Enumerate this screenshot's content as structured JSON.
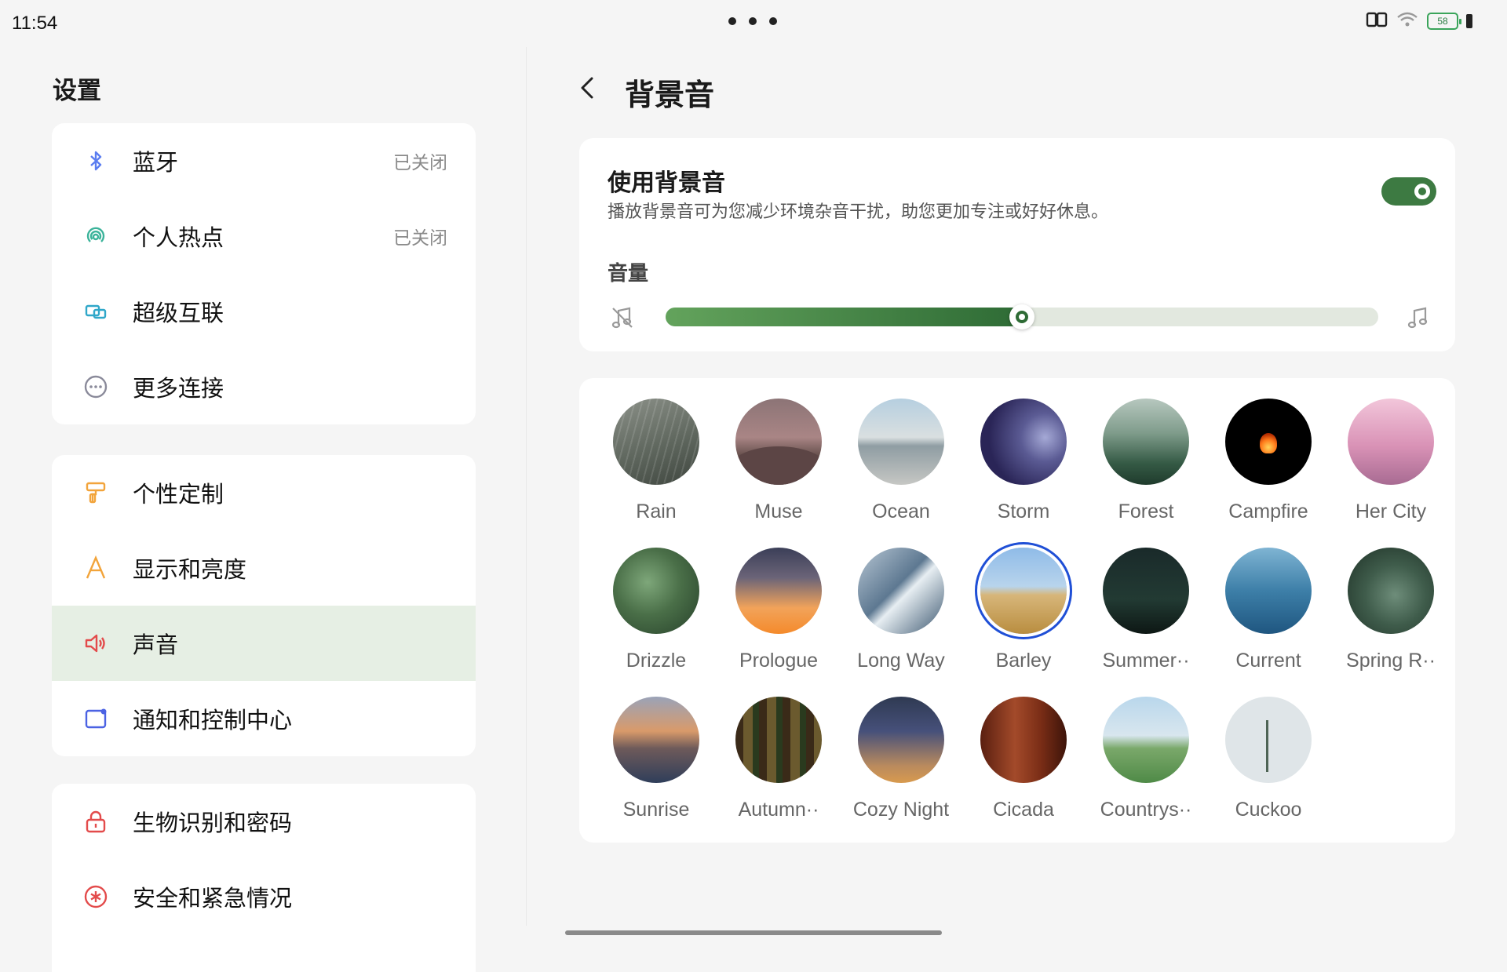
{
  "status_bar": {
    "time": "11:54",
    "battery": "58"
  },
  "left": {
    "title": "设置",
    "groups": [
      {
        "items": [
          {
            "label": "蓝牙",
            "state": "已关闭",
            "icon": "bluetooth-icon",
            "color": "#5b7df0"
          },
          {
            "label": "个人热点",
            "state": "已关闭",
            "icon": "hotspot-icon",
            "color": "#3bb39a"
          },
          {
            "label": "超级互联",
            "state": "",
            "icon": "super-connect-icon",
            "color": "#2fa7c9"
          },
          {
            "label": "更多连接",
            "state": "",
            "icon": "more-connections-icon",
            "color": "#8a8a9a"
          }
        ]
      },
      {
        "items": [
          {
            "label": "个性定制",
            "state": "",
            "icon": "paint-roller-icon",
            "color": "#f2a43b"
          },
          {
            "label": "显示和亮度",
            "state": "",
            "icon": "display-brightness-icon",
            "color": "#f2a43b"
          },
          {
            "label": "声音",
            "state": "",
            "icon": "speaker-icon",
            "color": "#e34b4b",
            "selected": true
          },
          {
            "label": "通知和控制中心",
            "state": "",
            "icon": "notification-icon",
            "color": "#4b62e3"
          }
        ]
      },
      {
        "items": [
          {
            "label": "生物识别和密码",
            "state": "",
            "icon": "lock-icon",
            "color": "#e34b4b"
          },
          {
            "label": "安全和紧急情况",
            "state": "",
            "icon": "emergency-icon",
            "color": "#e34b4b"
          }
        ]
      }
    ]
  },
  "right": {
    "title": "背景音",
    "toggle": {
      "title": "使用背景音",
      "description": "播放背景音可为您减少环境杂音干扰，助您更加专注或好好休息。",
      "enabled": true
    },
    "volume": {
      "label": "音量",
      "level": 0.5
    },
    "sounds": [
      [
        {
          "name": "Rain",
          "art": "t-rain"
        },
        {
          "name": "Muse",
          "art": "t-muse"
        },
        {
          "name": "Ocean",
          "art": "t-ocean"
        },
        {
          "name": "Storm",
          "art": "t-storm"
        },
        {
          "name": "Forest",
          "art": "t-forest"
        },
        {
          "name": "Campfire",
          "art": "t-campfire"
        },
        {
          "name": "Her City",
          "art": "t-hercity"
        }
      ],
      [
        {
          "name": "Drizzle",
          "art": "t-drizzle"
        },
        {
          "name": "Prologue",
          "art": "t-prologue"
        },
        {
          "name": "Long Way",
          "art": "t-longway"
        },
        {
          "name": "Barley",
          "art": "t-barley",
          "selected": true
        },
        {
          "name": "Summer··",
          "art": "t-summer"
        },
        {
          "name": "Current",
          "art": "t-current"
        },
        {
          "name": "Spring R··",
          "art": "t-spring"
        }
      ],
      [
        {
          "name": "Sunrise",
          "art": "t-sunrise"
        },
        {
          "name": "Autumn··",
          "art": "t-autumn"
        },
        {
          "name": "Cozy Night",
          "art": "t-cozy"
        },
        {
          "name": "Cicada",
          "art": "t-cicada"
        },
        {
          "name": "Countrys··",
          "art": "t-countryside"
        },
        {
          "name": "Cuckoo",
          "art": "t-cuckoo"
        }
      ]
    ]
  }
}
